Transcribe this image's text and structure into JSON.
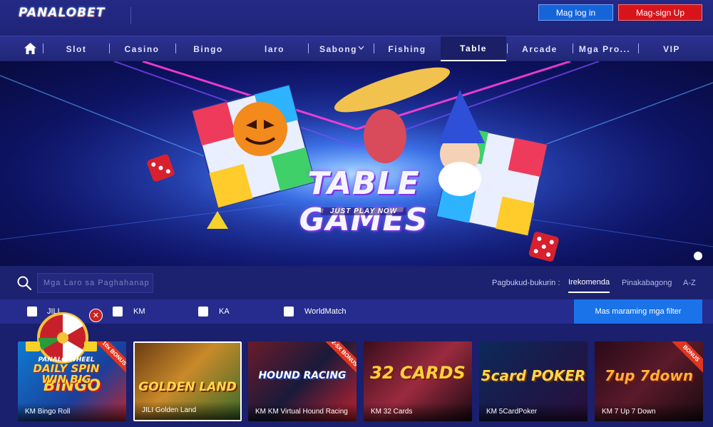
{
  "header": {
    "logo": "PANALOBET",
    "login_label": "Mag log in",
    "signup_label": "Mag-sign Up"
  },
  "nav": {
    "items": [
      {
        "label": "Slot"
      },
      {
        "label": "Casino"
      },
      {
        "label": "Bingo"
      },
      {
        "label": "laro"
      },
      {
        "label": "Sabong"
      },
      {
        "label": "Fishing"
      },
      {
        "label": "Table"
      },
      {
        "label": "Arcade"
      },
      {
        "label": "Mga Pro..."
      },
      {
        "label": "VIP"
      }
    ],
    "active": "Table"
  },
  "banner": {
    "title": "TABLE GAMES",
    "subtitle": "JUST PLAY NOW"
  },
  "search": {
    "placeholder": "Mga Laro sa Paghahanap"
  },
  "sort": {
    "label": "Pagbukud-bukurin :",
    "options": [
      {
        "label": "Irekomenda",
        "active": true
      },
      {
        "label": "Pinakabagong",
        "active": false
      },
      {
        "label": "A-Z",
        "active": false
      }
    ]
  },
  "filters": {
    "providers": [
      {
        "label": "JILI"
      },
      {
        "label": "KM"
      },
      {
        "label": "KA"
      },
      {
        "label": "WorldMatch"
      }
    ],
    "more_label": "Mas maraming mga filter"
  },
  "promo_wheel": {
    "line1": "PANALO WHEEL",
    "line2": "DAILY SPIN",
    "line3": "WIN BIG"
  },
  "games": [
    {
      "title": "KM Bingo Roll",
      "art": "BINGO",
      "badge": "10x BONUS"
    },
    {
      "title": "JILI Golden Land",
      "art": "GOLDEN LAND",
      "badge": ""
    },
    {
      "title": "KM KM Virtual Hound Racing",
      "art": "HOUND RACING",
      "badge": "2-5X BONUS"
    },
    {
      "title": "KM 32 Cards",
      "art": "32 CARDS",
      "badge": ""
    },
    {
      "title": "KM 5CardPoker",
      "art": "5card POKER",
      "badge": ""
    },
    {
      "title": "KM 7 Up 7 Down",
      "art": "7up 7down",
      "badge": "BONUS"
    }
  ],
  "colors": {
    "login_bg": "#1565d8",
    "signup_bg": "#d8141a",
    "filter_button": "#1a73e8",
    "page_bg": "#1a1f6e"
  }
}
